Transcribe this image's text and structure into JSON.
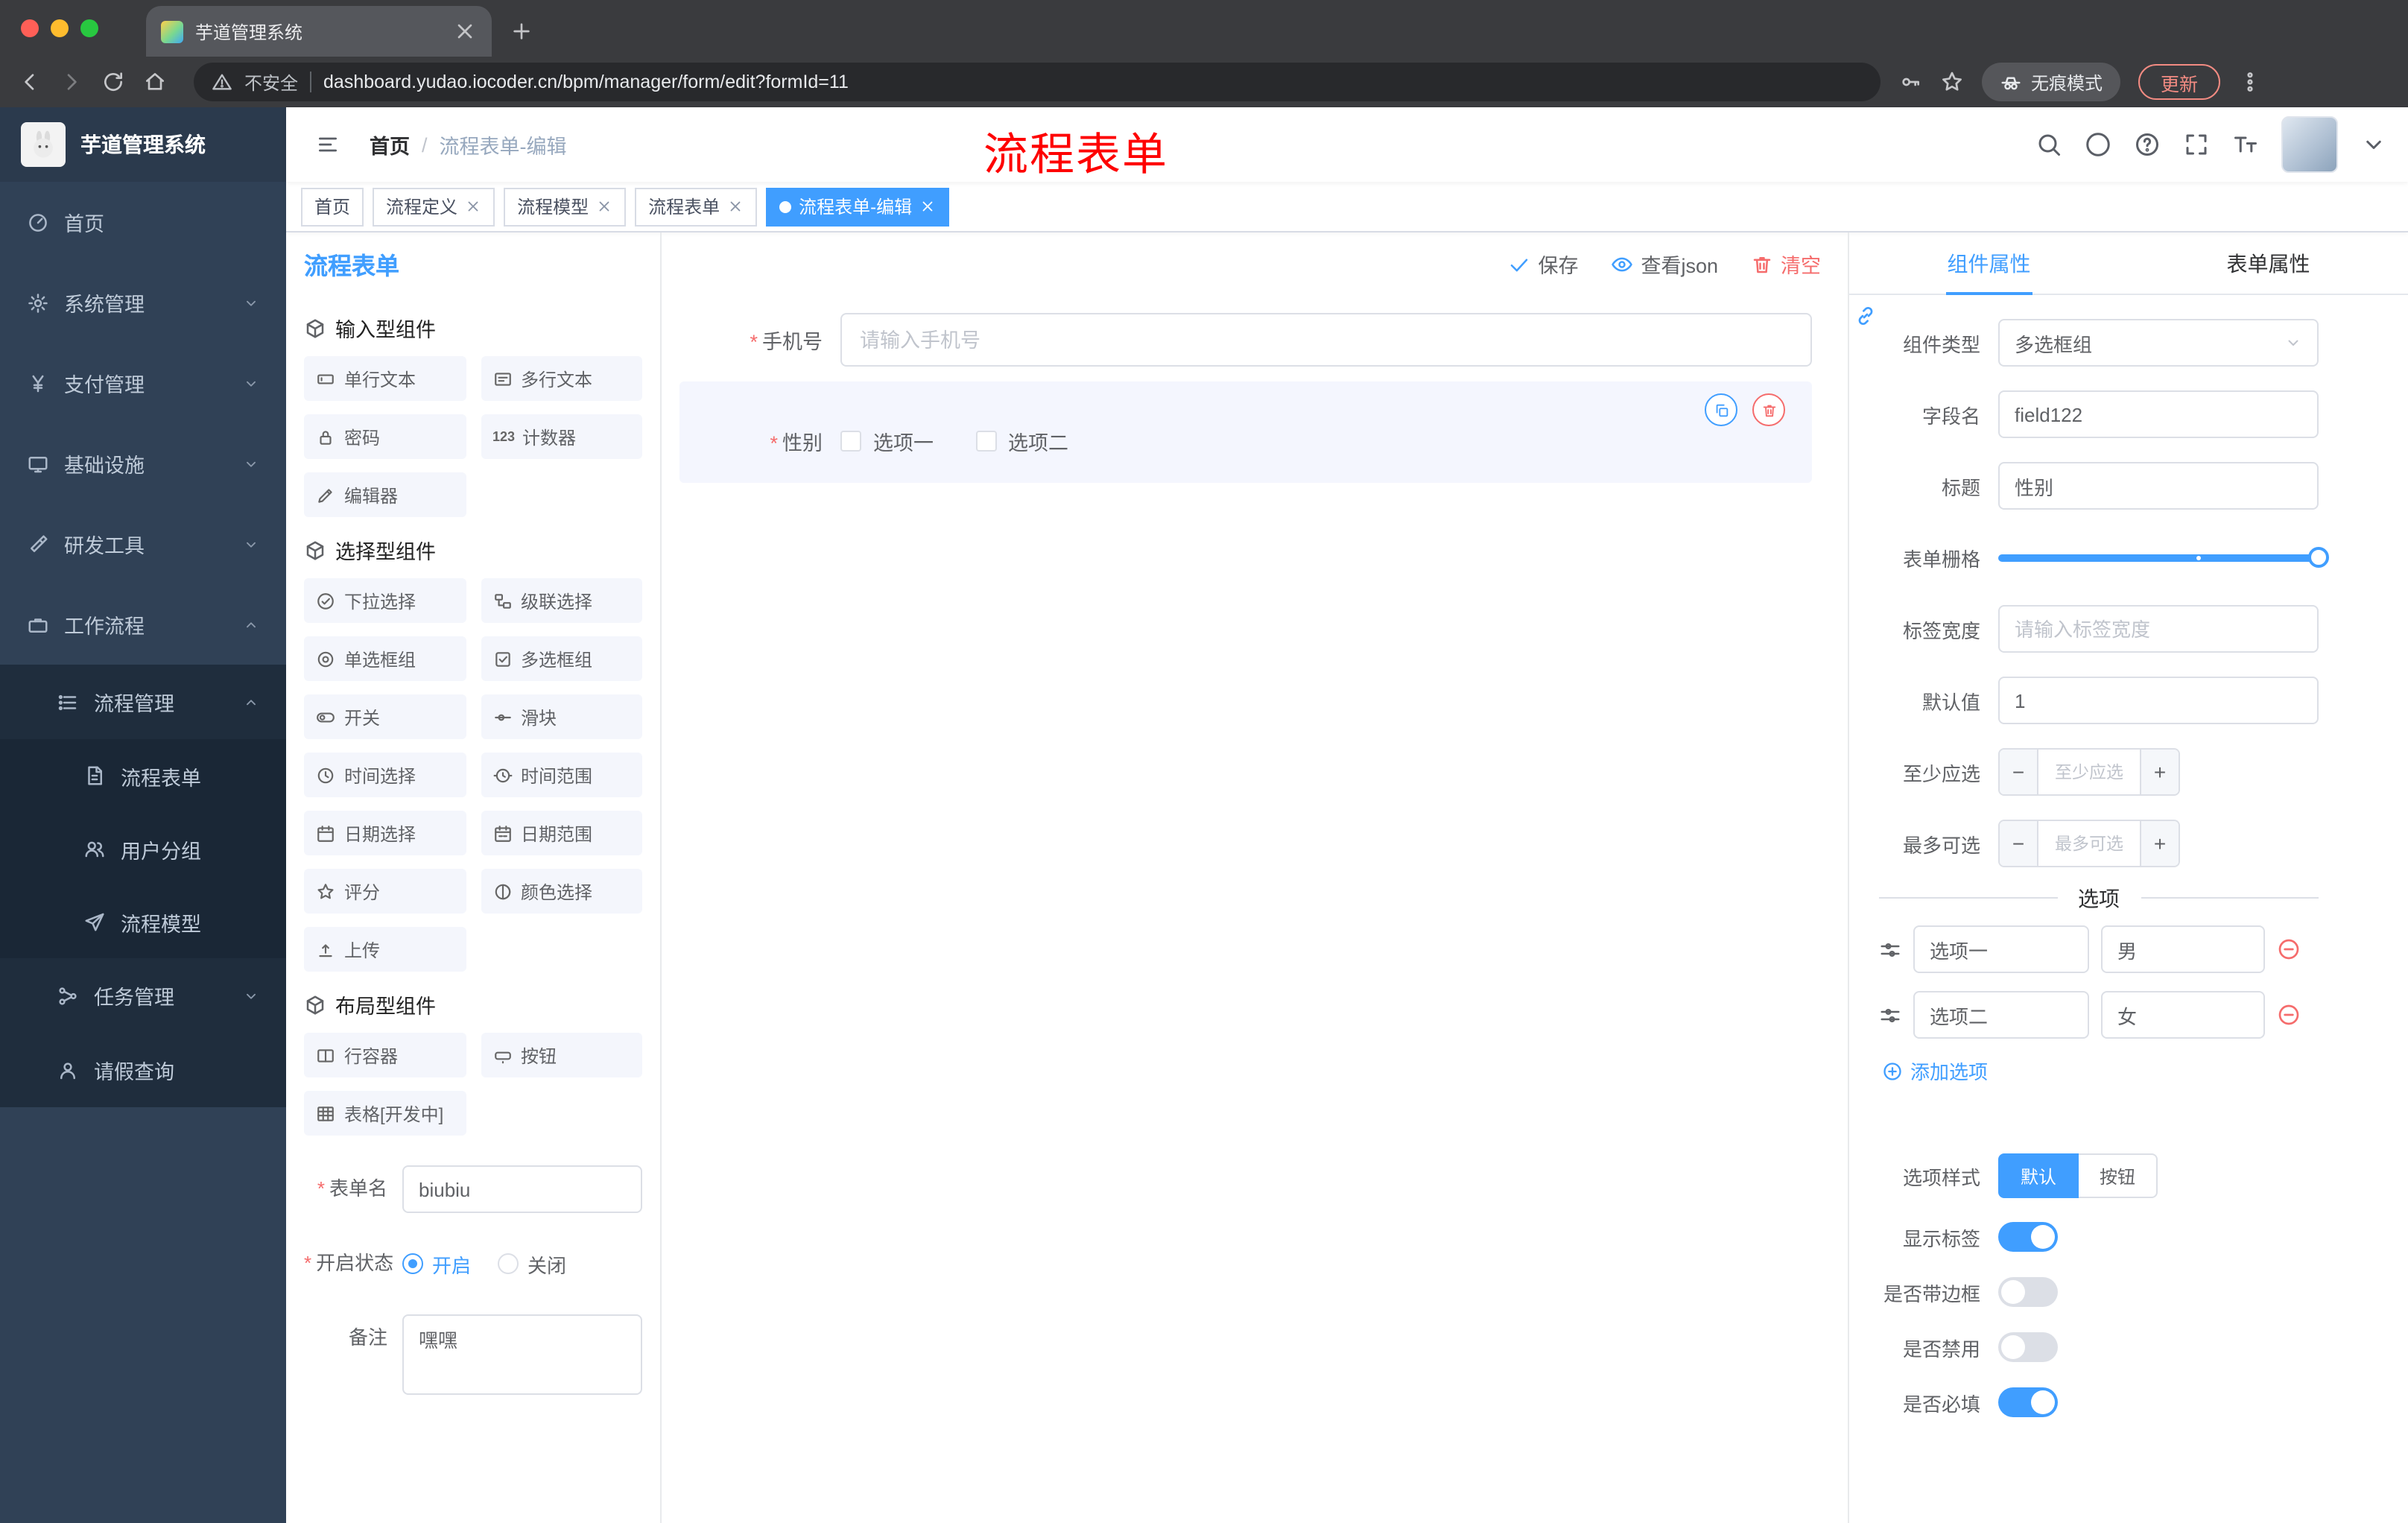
{
  "theme": {
    "accent": "#409eff",
    "danger": "#f56c6c",
    "sidebar_bg": "#304156",
    "submenu_bg": "#1f2d3d",
    "watermark_red": "#fe0000",
    "tag_active": "#409eff"
  },
  "browser": {
    "tab_title": "芋道管理系统",
    "security_label": "不安全",
    "url": "dashboard.yudao.iocoder.cn/bpm/manager/form/edit?formId=11",
    "incognito_label": "无痕模式",
    "update_label": "更新"
  },
  "sidebar": {
    "logo_title": "芋道管理系统",
    "items": [
      {
        "label": "首页",
        "icon": "gauge-icon"
      },
      {
        "label": "系统管理",
        "icon": "gear-icon"
      },
      {
        "label": "支付管理",
        "icon": "yen-icon"
      },
      {
        "label": "基础设施",
        "icon": "monitor-icon"
      },
      {
        "label": "研发工具",
        "icon": "tool-icon"
      },
      {
        "label": "工作流程",
        "icon": "briefcase-icon"
      }
    ],
    "workflow": {
      "process_mgmt": {
        "label": "流程管理",
        "children": [
          {
            "label": "流程表单",
            "icon": "document-icon"
          },
          {
            "label": "用户分组",
            "icon": "users-icon"
          },
          {
            "label": "流程模型",
            "icon": "plane-icon"
          }
        ]
      },
      "task_mgmt": {
        "label": "任务管理"
      },
      "leave_query": {
        "label": "请假查询"
      }
    }
  },
  "navbar": {
    "breadcrumb": {
      "home": "首页",
      "separator": "/",
      "current": "流程表单-编辑"
    },
    "watermark": "流程表单"
  },
  "tags": [
    {
      "label": "首页",
      "closable": false,
      "active": false
    },
    {
      "label": "流程定义",
      "closable": true,
      "active": false
    },
    {
      "label": "流程模型",
      "closable": true,
      "active": false
    },
    {
      "label": "流程表单",
      "closable": true,
      "active": false
    },
    {
      "label": "流程表单-编辑",
      "closable": true,
      "active": true
    }
  ],
  "designer": {
    "panel_title": "流程表单",
    "toolbar": {
      "save": "保存",
      "view_json": "查看json",
      "clear": "清空"
    },
    "sections": [
      {
        "title": "输入型组件",
        "items": [
          {
            "label": "单行文本"
          },
          {
            "label": "多行文本"
          },
          {
            "label": "密码"
          },
          {
            "label": "计数器"
          },
          {
            "label": "编辑器"
          }
        ]
      },
      {
        "title": "选择型组件",
        "items": [
          {
            "label": "下拉选择"
          },
          {
            "label": "级联选择"
          },
          {
            "label": "单选框组"
          },
          {
            "label": "多选框组"
          },
          {
            "label": "开关"
          },
          {
            "label": "滑块"
          },
          {
            "label": "时间选择"
          },
          {
            "label": "时间范围"
          },
          {
            "label": "日期选择"
          },
          {
            "label": "日期范围"
          },
          {
            "label": "评分"
          },
          {
            "label": "颜色选择"
          },
          {
            "label": "上传"
          }
        ]
      },
      {
        "title": "布局型组件",
        "items": [
          {
            "label": "行容器"
          },
          {
            "label": "按钮"
          },
          {
            "label": "表格[开发中]"
          }
        ]
      }
    ],
    "meta": {
      "name_label": "表单名",
      "name_value": "biubiu",
      "status_label": "开启状态",
      "status_on": "开启",
      "status_off": "关闭",
      "status_selected": "开启",
      "remark_label": "备注",
      "remark_value": "嘿嘿"
    },
    "canvas": {
      "phone": {
        "label": "手机号",
        "placeholder": "请输入手机号"
      },
      "gender": {
        "label": "性别",
        "option1": "选项一",
        "option2": "选项二"
      }
    }
  },
  "props": {
    "tab_component": "组件属性",
    "tab_form": "表单属性",
    "rows": {
      "type_label": "组件类型",
      "type_value": "多选框组",
      "field_label": "字段名",
      "field_value": "field122",
      "title_label": "标题",
      "title_value": "性别",
      "grid_label": "表单栅格",
      "width_label": "标签宽度",
      "width_placeholder": "请输入标签宽度",
      "default_label": "默认值",
      "default_value": "1",
      "min_label": "至少应选",
      "min_placeholder": "至少应选",
      "max_label": "最多可选",
      "max_placeholder": "最多可选"
    },
    "options_title": "选项",
    "options": [
      {
        "label": "选项一",
        "value": "男"
      },
      {
        "label": "选项二",
        "value": "女"
      }
    ],
    "add_option": "添加选项",
    "style_label": "选项样式",
    "style_default": "默认",
    "style_button": "按钮",
    "style_selected": "默认",
    "switch_show_label": "显示标签",
    "switch_show_on": true,
    "switch_border": "是否带边框",
    "switch_border_on": false,
    "switch_disabled": "是否禁用",
    "switch_disabled_on": false,
    "switch_required": "是否必填",
    "switch_required_on": true
  }
}
